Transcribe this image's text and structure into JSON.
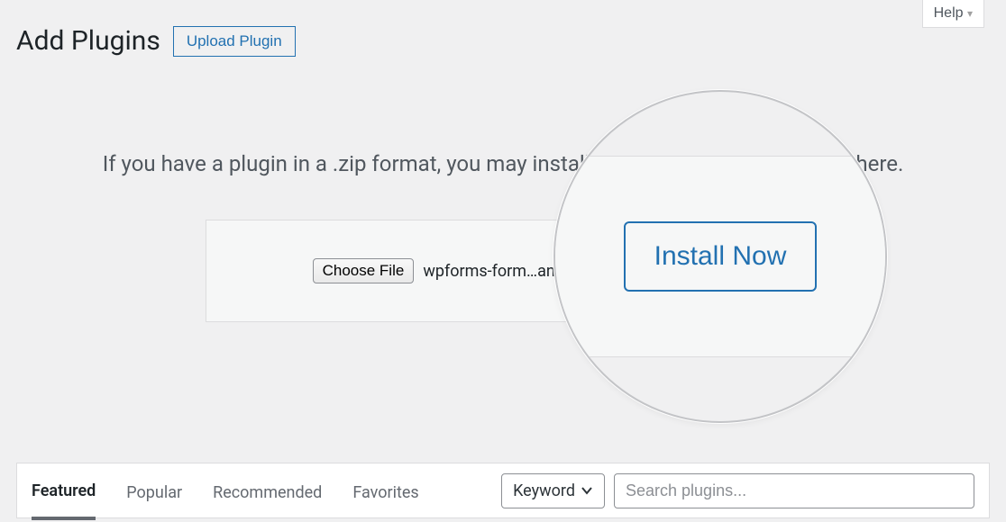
{
  "help": {
    "label": "Help"
  },
  "page": {
    "title": "Add Plugins"
  },
  "upload": {
    "button_label": "Upload Plugin",
    "instruction": "If you have a plugin in a .zip format, you may install or update it by uploading it here.",
    "choose_file_label": "Choose File",
    "chosen_filename": "wpforms-form…andon",
    "install_label": "Install Now"
  },
  "filters": {
    "links": [
      "Featured",
      "Popular",
      "Recommended",
      "Favorites"
    ],
    "keyword_label": "Keyword",
    "search_placeholder": "Search plugins..."
  },
  "colors": {
    "accent": "#2271b1",
    "bg": "#f0f0f1",
    "panel": "#f6f7f7",
    "text": "#3c434a",
    "muted": "#646970",
    "border": "#dcdcde"
  }
}
